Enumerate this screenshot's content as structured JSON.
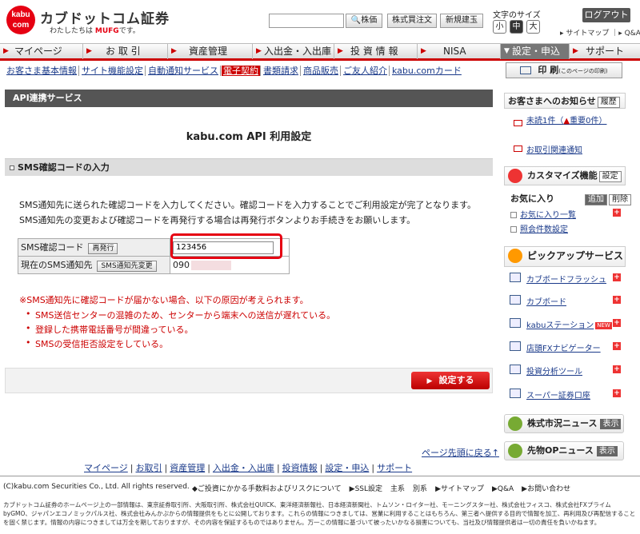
{
  "header": {
    "logo_badge": "kabu com",
    "logo_title": "カブドットコム証券",
    "logo_sub_prefix": "わたしたちは",
    "logo_sub_brand": "MUFG",
    "logo_sub_suffix": "です。",
    "search_placeholder": "",
    "search_button": "株価",
    "buttons": [
      "株式買注文",
      "新規建玉"
    ],
    "font_size_label": "文字のサイズ",
    "font_sizes": [
      "小",
      "中",
      "大"
    ],
    "logout": "ログアウト",
    "sitemap": "サイトマップ",
    "qa": "Q&A"
  },
  "nav": {
    "items": [
      "マイページ",
      "お 取 引",
      "資産管理",
      "入出金・入出庫",
      "投 資 情 報",
      "NISA",
      "設定・申込",
      "サポート"
    ]
  },
  "subnav": {
    "items": [
      "お客さま基本情報",
      "サイト機能設定",
      "自動通知サービス",
      "電子契約",
      "書類請求",
      "商品販売",
      "ご友人紹介",
      "kabu.comカード"
    ],
    "active_index": 3
  },
  "print": {
    "label": "印 刷",
    "note": "(このページの印刷)"
  },
  "main": {
    "title_bar": "API連携サービス",
    "heading": "kabu.com API 利用設定",
    "section": "SMS確認コードの入力",
    "desc_line1": "SMS通知先に送られた確認コードを入力してください。確認コードを入力することでご利用設定が完了となります。",
    "desc_line2": "SMS通知先の変更および確認コードを再発行する場合は再発行ボタンよりお手続きをお願いします。",
    "form": {
      "code_label": "SMS確認コード",
      "reissue_button": "再発行",
      "code_value": "123456",
      "phone_label": "現在のSMS通知先",
      "change_button": "SMS通知先変更",
      "phone_value": "090"
    },
    "warning_title": "※SMS通知先に確認コードが届かない場合、以下の原因が考えられます。",
    "warnings": [
      "SMS送信センターの混雑のため、センターから端末への送信が遅れている。",
      "登録した携帯電話番号が間違っている。",
      "SMSの受信拒否設定をしている。"
    ],
    "submit": "設定する",
    "back_to_top": "ページ先頭に戻る↑",
    "footnav": [
      "マイページ",
      "お取引",
      "資産管理",
      "入出金・入出庫",
      "投資情報",
      "設定・申込",
      "サポート"
    ]
  },
  "right": {
    "notice_title": "お客さまへのお知らせ",
    "history_button": "履歴",
    "unread": "未読1件（",
    "important": "重要0件）",
    "trade_notice": "お取引関連通知",
    "customize_title": "カスタマイズ機能",
    "setting_button": "設定",
    "fav_title": "お気に入り",
    "add_button": "追加",
    "delete_button": "削除",
    "fav_items": [
      "お気に入り一覧",
      "照会件数設定"
    ],
    "pickup_title": "ピックアップサービス",
    "services": [
      "カブボードフラッシュ",
      "カブボード",
      "kabuステーション",
      "店頭FXナビゲーター",
      "投資分析ツール",
      "スーパー証券口座"
    ],
    "new_badge": "NEW",
    "news1": "株式市況ニュース",
    "news2": "先物OPニュース",
    "show_button": "表示"
  },
  "footer": {
    "copyright": "(C)kabu.com Securities Co., Ltd. All rights reserved.",
    "links": [
      "◆ご投資にかかる手数料およびリスクについて",
      "▶SSL設定",
      "主系",
      "別系",
      "▶サイトマップ",
      "▶Q&A",
      "▶お問い合わせ"
    ],
    "disclaimer": "カブドットコム証券のホームページ上の一部情報は、東京証券取引所、大阪取引所、株式会社QUICK、東洋経済新報社、日本経済新聞社、トムソン・ロイター社、モーニングスター社、株式会社フィスコ、株式会社FXプライムbyGMO、ジャパンエコノミックパルス社、株式会社みんかぶからの情報提供をもとに公開しております。これらの情報につきましては、営業に利用することはもちろん、第三者へ提供する目的で情報を加工、再利用及び再配信することを固く禁じます。情報の内容につきましては万全を期しておりますが、その内容を保証するものではありません。万一この情報に基づいて被ったいかなる損害についても、当社及び情報提供者は一切の責任を負いかねます。"
  },
  "colors": {
    "brand_red": "#e60012",
    "link_blue": "#1a3a8a",
    "title_gray": "#555555"
  }
}
